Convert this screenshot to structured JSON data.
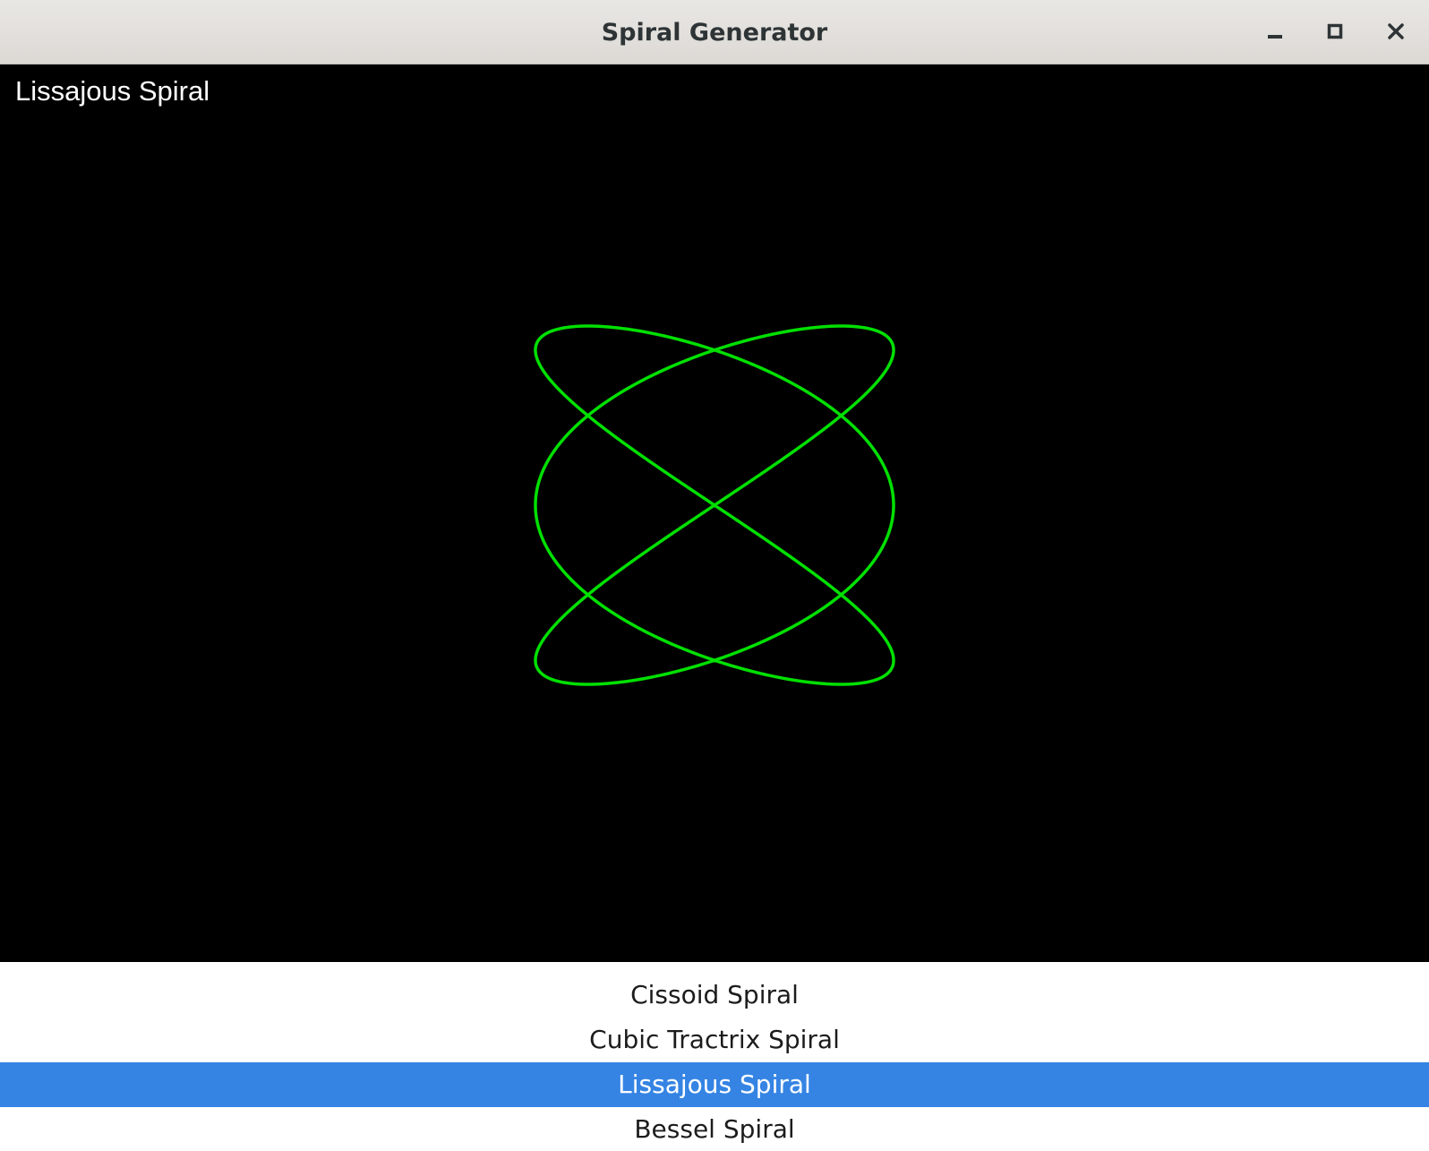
{
  "window": {
    "title": "Spiral Generator"
  },
  "canvas": {
    "label": "Lissajous Spiral",
    "background_color": "#000000",
    "curve_color": "#00e000"
  },
  "spiral_list": {
    "items": [
      {
        "label": "Cissoid Spiral",
        "selected": false
      },
      {
        "label": "Cubic Tractrix Spiral",
        "selected": false
      },
      {
        "label": "Lissajous Spiral",
        "selected": true
      },
      {
        "label": "Bessel Spiral",
        "selected": false
      }
    ],
    "selected_color": "#3584e4"
  },
  "icons": {
    "minimize": "minimize-icon",
    "maximize": "maximize-icon",
    "close": "close-icon"
  }
}
